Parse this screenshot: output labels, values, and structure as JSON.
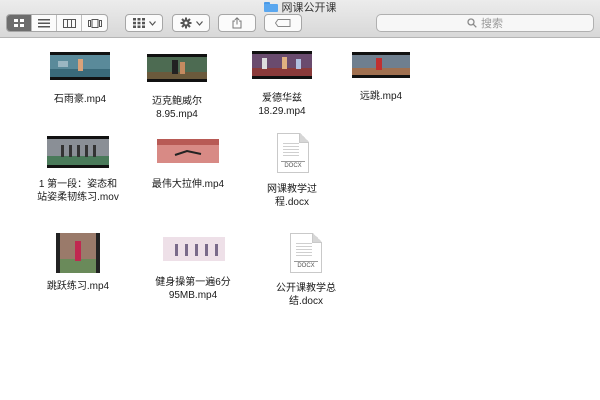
{
  "window": {
    "title": "网课公开课"
  },
  "toolbar": {
    "view_modes": [
      "icon-view",
      "list-view",
      "column-view",
      "coverflow-view"
    ],
    "search_placeholder": "搜索"
  },
  "files": [
    {
      "name_lines": [
        "石雨豪.mp4"
      ],
      "kind": "video"
    },
    {
      "name_lines": [
        "迈克鲍威尔",
        "8.95.mp4"
      ],
      "kind": "video"
    },
    {
      "name_lines": [
        "爱德华兹",
        "18.29.mp4"
      ],
      "kind": "video"
    },
    {
      "name_lines": [
        "远跳.mp4"
      ],
      "kind": "video"
    },
    {
      "name_lines": [
        "1 第一段：姿态和",
        "站姿柔韧练习.mov"
      ],
      "kind": "video"
    },
    {
      "name_lines": [
        "最伟大拉伸.mp4"
      ],
      "kind": "video"
    },
    {
      "name_lines": [
        "网课教学过",
        "程.docx"
      ],
      "kind": "docx",
      "badge": "DOCX"
    },
    {
      "name_lines": [
        "跳跃练习.mp4"
      ],
      "kind": "video"
    },
    {
      "name_lines": [
        "健身操第一遍6分",
        "95MB.mp4"
      ],
      "kind": "video"
    },
    {
      "name_lines": [
        "公开课教学总",
        "结.docx"
      ],
      "kind": "docx",
      "badge": "DOCX"
    }
  ]
}
